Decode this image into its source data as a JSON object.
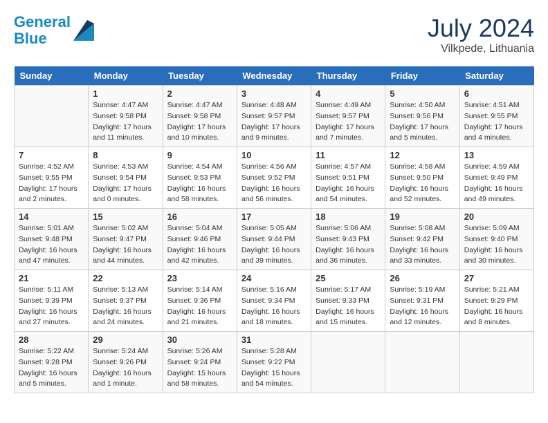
{
  "logo": {
    "line1": "General",
    "line2": "Blue"
  },
  "title": {
    "month_year": "July 2024",
    "location": "Vilkpede, Lithuania"
  },
  "days_of_week": [
    "Sunday",
    "Monday",
    "Tuesday",
    "Wednesday",
    "Thursday",
    "Friday",
    "Saturday"
  ],
  "weeks": [
    [
      {
        "day": "",
        "data": ""
      },
      {
        "day": "1",
        "data": "Sunrise: 4:47 AM\nSunset: 9:58 PM\nDaylight: 17 hours\nand 11 minutes."
      },
      {
        "day": "2",
        "data": "Sunrise: 4:47 AM\nSunset: 9:58 PM\nDaylight: 17 hours\nand 10 minutes."
      },
      {
        "day": "3",
        "data": "Sunrise: 4:48 AM\nSunset: 9:57 PM\nDaylight: 17 hours\nand 9 minutes."
      },
      {
        "day": "4",
        "data": "Sunrise: 4:49 AM\nSunset: 9:57 PM\nDaylight: 17 hours\nand 7 minutes."
      },
      {
        "day": "5",
        "data": "Sunrise: 4:50 AM\nSunset: 9:56 PM\nDaylight: 17 hours\nand 5 minutes."
      },
      {
        "day": "6",
        "data": "Sunrise: 4:51 AM\nSunset: 9:55 PM\nDaylight: 17 hours\nand 4 minutes."
      }
    ],
    [
      {
        "day": "7",
        "data": "Sunrise: 4:52 AM\nSunset: 9:55 PM\nDaylight: 17 hours\nand 2 minutes."
      },
      {
        "day": "8",
        "data": "Sunrise: 4:53 AM\nSunset: 9:54 PM\nDaylight: 17 hours\nand 0 minutes."
      },
      {
        "day": "9",
        "data": "Sunrise: 4:54 AM\nSunset: 9:53 PM\nDaylight: 16 hours\nand 58 minutes."
      },
      {
        "day": "10",
        "data": "Sunrise: 4:56 AM\nSunset: 9:52 PM\nDaylight: 16 hours\nand 56 minutes."
      },
      {
        "day": "11",
        "data": "Sunrise: 4:57 AM\nSunset: 9:51 PM\nDaylight: 16 hours\nand 54 minutes."
      },
      {
        "day": "12",
        "data": "Sunrise: 4:58 AM\nSunset: 9:50 PM\nDaylight: 16 hours\nand 52 minutes."
      },
      {
        "day": "13",
        "data": "Sunrise: 4:59 AM\nSunset: 9:49 PM\nDaylight: 16 hours\nand 49 minutes."
      }
    ],
    [
      {
        "day": "14",
        "data": "Sunrise: 5:01 AM\nSunset: 9:48 PM\nDaylight: 16 hours\nand 47 minutes."
      },
      {
        "day": "15",
        "data": "Sunrise: 5:02 AM\nSunset: 9:47 PM\nDaylight: 16 hours\nand 44 minutes."
      },
      {
        "day": "16",
        "data": "Sunrise: 5:04 AM\nSunset: 9:46 PM\nDaylight: 16 hours\nand 42 minutes."
      },
      {
        "day": "17",
        "data": "Sunrise: 5:05 AM\nSunset: 9:44 PM\nDaylight: 16 hours\nand 39 minutes."
      },
      {
        "day": "18",
        "data": "Sunrise: 5:06 AM\nSunset: 9:43 PM\nDaylight: 16 hours\nand 36 minutes."
      },
      {
        "day": "19",
        "data": "Sunrise: 5:08 AM\nSunset: 9:42 PM\nDaylight: 16 hours\nand 33 minutes."
      },
      {
        "day": "20",
        "data": "Sunrise: 5:09 AM\nSunset: 9:40 PM\nDaylight: 16 hours\nand 30 minutes."
      }
    ],
    [
      {
        "day": "21",
        "data": "Sunrise: 5:11 AM\nSunset: 9:39 PM\nDaylight: 16 hours\nand 27 minutes."
      },
      {
        "day": "22",
        "data": "Sunrise: 5:13 AM\nSunset: 9:37 PM\nDaylight: 16 hours\nand 24 minutes."
      },
      {
        "day": "23",
        "data": "Sunrise: 5:14 AM\nSunset: 9:36 PM\nDaylight: 16 hours\nand 21 minutes."
      },
      {
        "day": "24",
        "data": "Sunrise: 5:16 AM\nSunset: 9:34 PM\nDaylight: 16 hours\nand 18 minutes."
      },
      {
        "day": "25",
        "data": "Sunrise: 5:17 AM\nSunset: 9:33 PM\nDaylight: 16 hours\nand 15 minutes."
      },
      {
        "day": "26",
        "data": "Sunrise: 5:19 AM\nSunset: 9:31 PM\nDaylight: 16 hours\nand 12 minutes."
      },
      {
        "day": "27",
        "data": "Sunrise: 5:21 AM\nSunset: 9:29 PM\nDaylight: 16 hours\nand 8 minutes."
      }
    ],
    [
      {
        "day": "28",
        "data": "Sunrise: 5:22 AM\nSunset: 9:28 PM\nDaylight: 16 hours\nand 5 minutes."
      },
      {
        "day": "29",
        "data": "Sunrise: 5:24 AM\nSunset: 9:26 PM\nDaylight: 16 hours\nand 1 minute."
      },
      {
        "day": "30",
        "data": "Sunrise: 5:26 AM\nSunset: 9:24 PM\nDaylight: 15 hours\nand 58 minutes."
      },
      {
        "day": "31",
        "data": "Sunrise: 5:28 AM\nSunset: 9:22 PM\nDaylight: 15 hours\nand 54 minutes."
      },
      {
        "day": "",
        "data": ""
      },
      {
        "day": "",
        "data": ""
      },
      {
        "day": "",
        "data": ""
      }
    ]
  ]
}
